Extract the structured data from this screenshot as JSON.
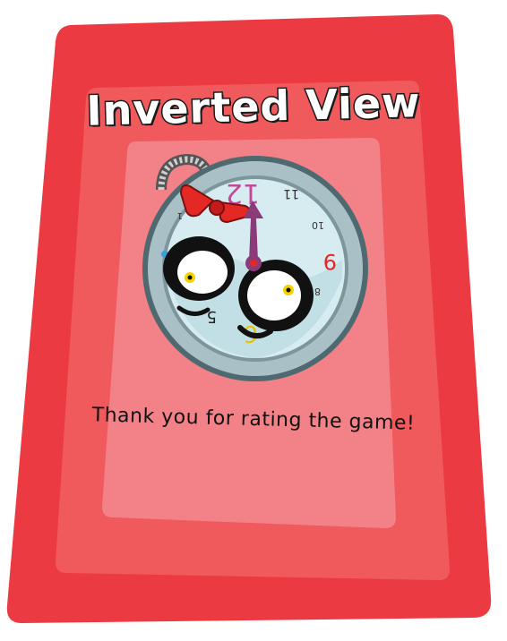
{
  "dialog": {
    "title": "Inverted View",
    "message": "Thank you for rating the game!"
  },
  "clock": {
    "numerals": {
      "twelve": "12",
      "eleven": "11",
      "ten": "10",
      "nine": "9",
      "eight": "8",
      "six": "6",
      "five": "5",
      "one": "1"
    }
  },
  "colors": {
    "card_outer": "#ec3a43",
    "card_middle": "#f05a5c",
    "card_inner": "#f07f86",
    "clock_rim": "#a9c1c6",
    "clock_face": "#d6ecf1",
    "hand": "#8b3a7a",
    "bow": "#e42824"
  },
  "icons": {
    "clock_character": "cute-clock-face-icon",
    "bow": "red-bow-icon",
    "crank": "wind-up-crank-icon"
  }
}
